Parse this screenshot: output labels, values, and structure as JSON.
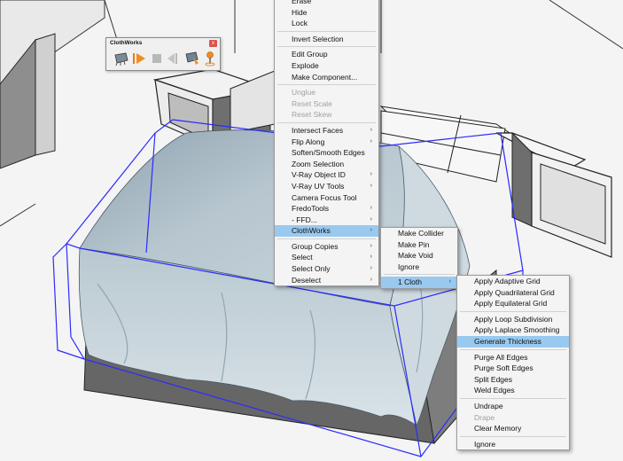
{
  "toolbar": {
    "title": "ClothWorks",
    "close_label": "x",
    "icons": [
      "cloth-icon",
      "play-icon",
      "stop-icon",
      "reset-icon",
      "drape-icon",
      "pin-icon"
    ]
  },
  "context_menu": {
    "items": [
      {
        "label": "Erase",
        "disabled": false,
        "submenu": false
      },
      {
        "label": "Hide",
        "disabled": false,
        "submenu": false
      },
      {
        "label": "Lock",
        "disabled": false,
        "submenu": false
      },
      {
        "separator": true
      },
      {
        "label": "Invert Selection",
        "disabled": false,
        "submenu": false
      },
      {
        "separator": true
      },
      {
        "label": "Edit Group",
        "disabled": false,
        "submenu": false
      },
      {
        "label": "Explode",
        "disabled": false,
        "submenu": false
      },
      {
        "label": "Make Component...",
        "disabled": false,
        "submenu": false
      },
      {
        "separator": true
      },
      {
        "label": "Unglue",
        "disabled": true,
        "submenu": false
      },
      {
        "label": "Reset Scale",
        "disabled": true,
        "submenu": false
      },
      {
        "label": "Reset Skew",
        "disabled": true,
        "submenu": false
      },
      {
        "separator": true
      },
      {
        "label": "Intersect Faces",
        "disabled": false,
        "submenu": true
      },
      {
        "label": "Flip Along",
        "disabled": false,
        "submenu": true
      },
      {
        "label": "Soften/Smooth Edges",
        "disabled": false,
        "submenu": false
      },
      {
        "label": "Zoom Selection",
        "disabled": false,
        "submenu": false
      },
      {
        "label": "V-Ray Object ID",
        "disabled": false,
        "submenu": true
      },
      {
        "label": "V-Ray UV Tools",
        "disabled": false,
        "submenu": true
      },
      {
        "label": "Camera Focus Tool",
        "disabled": false,
        "submenu": false
      },
      {
        "label": "FredoTools",
        "disabled": false,
        "submenu": true
      },
      {
        "label": "- FFD...",
        "disabled": false,
        "submenu": true
      },
      {
        "label": "ClothWorks",
        "disabled": false,
        "submenu": true,
        "state": "highlight"
      },
      {
        "separator": true
      },
      {
        "label": "Group Copies",
        "disabled": false,
        "submenu": true
      },
      {
        "label": "Select",
        "disabled": false,
        "submenu": true
      },
      {
        "label": "Select Only",
        "disabled": false,
        "submenu": true
      },
      {
        "label": "Deselect",
        "disabled": false,
        "submenu": true
      }
    ]
  },
  "clothworks_submenu": {
    "items": [
      {
        "label": "Make Collider",
        "submenu": false
      },
      {
        "label": "Make Pin",
        "submenu": false
      },
      {
        "label": "Make Void",
        "submenu": false
      },
      {
        "label": "Ignore",
        "submenu": false
      },
      {
        "separator": true
      },
      {
        "label": "1 Cloth",
        "submenu": true,
        "state": "highlight"
      }
    ]
  },
  "cloth_submenu": {
    "items": [
      {
        "label": "Apply Adaptive Grid",
        "disabled": false
      },
      {
        "label": "Apply Quadrilateral Grid",
        "disabled": false
      },
      {
        "label": "Apply Equilateral Grid",
        "disabled": false
      },
      {
        "separator": true
      },
      {
        "label": "Apply Loop Subdivision",
        "disabled": false
      },
      {
        "label": "Apply Laplace Smoothing",
        "disabled": false
      },
      {
        "label": "Generate Thickness",
        "disabled": false,
        "state": "highlight"
      },
      {
        "separator": true
      },
      {
        "label": "Purge All Edges",
        "disabled": false
      },
      {
        "label": "Purge Soft Edges",
        "disabled": false
      },
      {
        "label": "Split Edges",
        "disabled": false
      },
      {
        "label": "Weld Edges",
        "disabled": false
      },
      {
        "separator": true
      },
      {
        "label": "Undrape",
        "disabled": false
      },
      {
        "label": "Drape",
        "disabled": true
      },
      {
        "label": "Clear Memory",
        "disabled": false
      },
      {
        "separator": true
      },
      {
        "label": "Ignore",
        "disabled": false
      }
    ]
  },
  "colors": {
    "selection": "#2b2bff",
    "cloth": "#aab9c3",
    "highlight": "#99c9ef",
    "menu_bg": "#f4f4f4"
  }
}
